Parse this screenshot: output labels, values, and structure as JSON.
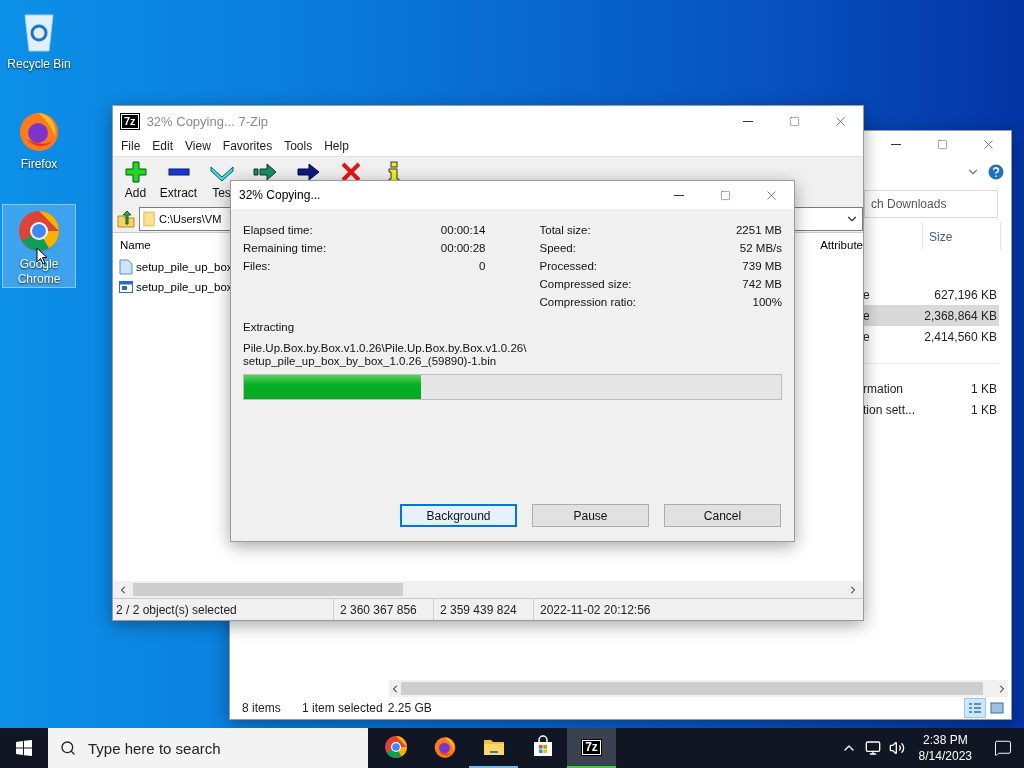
{
  "desktop_icons": [
    {
      "kind": "recycle-bin",
      "label": "Recycle Bin",
      "selected": false
    },
    {
      "kind": "firefox",
      "label": "Firefox",
      "selected": false
    },
    {
      "kind": "chrome",
      "label": "Google Chrome",
      "selected": true
    }
  ],
  "explorer": {
    "search": {
      "placeholder": "ch Downloads"
    },
    "columns": [
      "Size"
    ],
    "groups": [
      [
        {
          "name": "e",
          "size": "627,196 KB",
          "selected": false
        },
        {
          "name": "e",
          "size": "2,368,864 KB",
          "selected": true
        },
        {
          "name": "e",
          "size": "2,414,560 KB",
          "selected": false
        }
      ],
      [
        {
          "name": "rmation",
          "size": "1 KB",
          "selected": false
        },
        {
          "name": "tion sett...",
          "size": "1 KB",
          "selected": false
        }
      ]
    ],
    "status": {
      "items": "8 items",
      "selection": "1 item selected",
      "size": "2.25 GB"
    },
    "views": [
      {
        "kind": "details",
        "selected": true
      },
      {
        "kind": "large-icons",
        "selected": false
      }
    ]
  },
  "seven_zip": {
    "logo": "7z",
    "title": "32% Copying... 7-Zip",
    "menu": [
      "File",
      "Edit",
      "View",
      "Favorites",
      "Tools",
      "Help"
    ],
    "toolbar": [
      {
        "kind": "add",
        "label": "Add"
      },
      {
        "kind": "extract",
        "label": "Extract"
      },
      {
        "kind": "test",
        "label": "Tes"
      },
      {
        "kind": "copy"
      },
      {
        "kind": "move"
      },
      {
        "kind": "delete"
      },
      {
        "kind": "info"
      }
    ],
    "address": "C:\\Users\\VM",
    "columns": [
      "Name",
      "Attribute"
    ],
    "files": [
      {
        "kind": "document",
        "name": "setup_pile_up_box"
      },
      {
        "kind": "program",
        "name": "setup_pile_up_box"
      }
    ],
    "status": [
      "2 / 2 object(s) selected",
      "2 360 367 856",
      "2 359 439 824",
      "2022-11-02 20:12:56"
    ]
  },
  "dialog": {
    "title": "32% Copying...",
    "left_stats": [
      {
        "label": "Elapsed time:",
        "value": "00:00:14"
      },
      {
        "label": "Remaining time:",
        "value": "00:00:28"
      },
      {
        "label": "Files:",
        "value": "0"
      }
    ],
    "right_stats": [
      {
        "label": "Total size:",
        "value": "2251 MB"
      },
      {
        "label": "Speed:",
        "value": "52 MB/s"
      },
      {
        "label": "Processed:",
        "value": "739 MB"
      },
      {
        "label": "Compressed size:",
        "value": "742 MB"
      },
      {
        "label": "Compression ratio:",
        "value": "100%"
      }
    ],
    "operation": "Extracting",
    "path": [
      "Pile.Up.Box.by.Box.v1.0.26\\Pile.Up.Box.by.Box.v1.0.26\\",
      "setup_pile_up_box_by_box_1.0.26_(59890)-1.bin"
    ],
    "progress": {
      "level": 0.33
    },
    "buttons": [
      {
        "label": "Background",
        "selected": true
      },
      {
        "label": "Pause",
        "selected": false
      },
      {
        "label": "Cancel",
        "selected": false
      }
    ]
  },
  "taskbar": {
    "search": {
      "placeholder": "Type here to search"
    },
    "apps": [
      {
        "kind": "chrome",
        "running": false,
        "selected": false
      },
      {
        "kind": "firefox",
        "running": false,
        "selected": false
      },
      {
        "kind": "explorer",
        "running": true,
        "selected": false
      },
      {
        "kind": "store",
        "running": false,
        "selected": false
      },
      {
        "kind": "sevenzip",
        "logo": "7z",
        "running": true,
        "selected": true
      }
    ],
    "time": "2:38 PM",
    "date": "8/14/2023"
  }
}
